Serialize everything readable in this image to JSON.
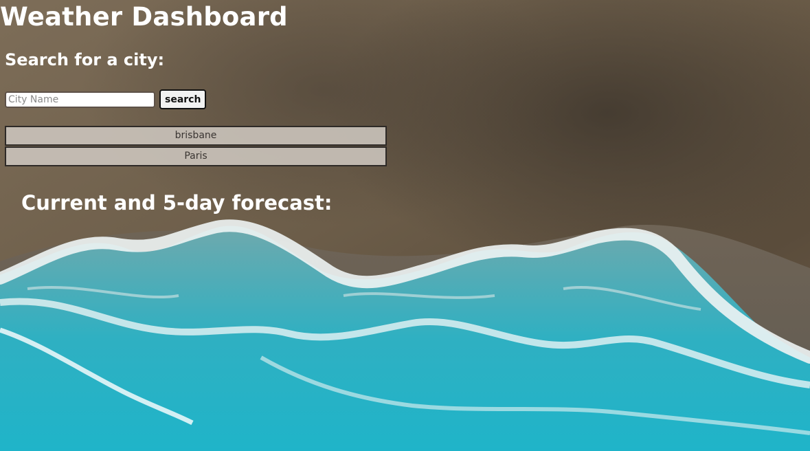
{
  "header": {
    "title": "Weather Dashboard"
  },
  "search": {
    "heading": "Search for a city:",
    "input_placeholder": "City Name",
    "input_value": "",
    "button_label": "search"
  },
  "history": {
    "items": [
      {
        "label": "brisbane"
      },
      {
        "label": "Paris"
      }
    ]
  },
  "forecast": {
    "heading": "Current and 5-day forecast:"
  },
  "background": {
    "subject": "aerial beach with waves",
    "sand_color": "#6f604c",
    "ocean_color": "#2bb3c4",
    "foam_color": "#e8f1f1"
  }
}
